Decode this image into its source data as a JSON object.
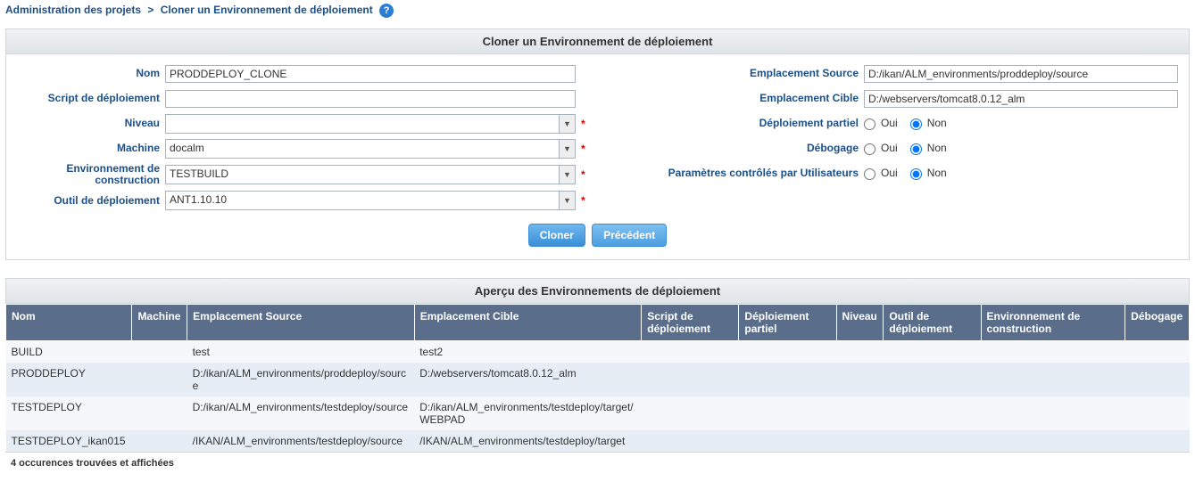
{
  "breadcrumb": {
    "part1": "Administration des projets",
    "sep": ">",
    "part2": "Cloner un Environnement de déploiement"
  },
  "panel1": {
    "title": "Cloner un Environnement de déploiement"
  },
  "form": {
    "nom_label": "Nom",
    "nom_value": "PRODDEPLOY_CLONE",
    "script_label": "Script de déploiement",
    "script_value": "",
    "niveau_label": "Niveau",
    "niveau_value": "",
    "machine_label": "Machine",
    "machine_value": "docalm",
    "envconstr_label": "Environnement de construction",
    "envconstr_value": "TESTBUILD",
    "outil_label": "Outil de déploiement",
    "outil_value": "ANT1.10.10",
    "empsrc_label": "Emplacement Source",
    "empsrc_value": "D:/ikan/ALM_environments/proddeploy/source",
    "empcib_label": "Emplacement Cible",
    "empcib_value": "D:/webservers/tomcat8.0.12_alm",
    "partiel_label": "Déploiement partiel",
    "debug_label": "Débogage",
    "params_label": "Paramètres contrôlés par Utilisateurs",
    "oui": "Oui",
    "non": "Non"
  },
  "buttons": {
    "clone": "Cloner",
    "prev": "Précédent"
  },
  "table": {
    "title": "Aperçu des Environnements de déploiement",
    "headers": {
      "nom": "Nom",
      "machine": "Machine",
      "empsrc": "Emplacement Source",
      "empcib": "Emplacement Cible",
      "script": "Script de déploiement",
      "partiel": "Déploiement partiel",
      "niveau": "Niveau",
      "outil": "Outil de déploiement",
      "envconstr": "Environnement de construction",
      "debug": "Débogage"
    },
    "rows": [
      {
        "nom": "BUILD",
        "machine": "",
        "empsrc": "test",
        "empcib": "test2",
        "script": "",
        "partiel": "",
        "niveau": "",
        "outil": "",
        "envconstr": "",
        "debug": ""
      },
      {
        "nom": "PRODDEPLOY",
        "machine": "",
        "empsrc": "D:/ikan/ALM_environments/proddeploy/source",
        "empcib": "D:/webservers/tomcat8.0.12_alm",
        "script": "",
        "partiel": "",
        "niveau": "",
        "outil": "",
        "envconstr": "",
        "debug": ""
      },
      {
        "nom": "TESTDEPLOY",
        "machine": "",
        "empsrc": "D:/ikan/ALM_environments/testdeploy/source",
        "empcib": "D:/ikan/ALM_environments/testdeploy/target/WEBPAD",
        "script": "",
        "partiel": "",
        "niveau": "",
        "outil": "",
        "envconstr": "",
        "debug": ""
      },
      {
        "nom": "TESTDEPLOY_ikan015",
        "machine": "",
        "empsrc": "/IKAN/ALM_environments/testdeploy/source",
        "empcib": "/IKAN/ALM_environments/testdeploy/target",
        "script": "",
        "partiel": "",
        "niveau": "",
        "outil": "",
        "envconstr": "",
        "debug": ""
      }
    ],
    "footer": "4 occurences trouvées et affichées"
  }
}
